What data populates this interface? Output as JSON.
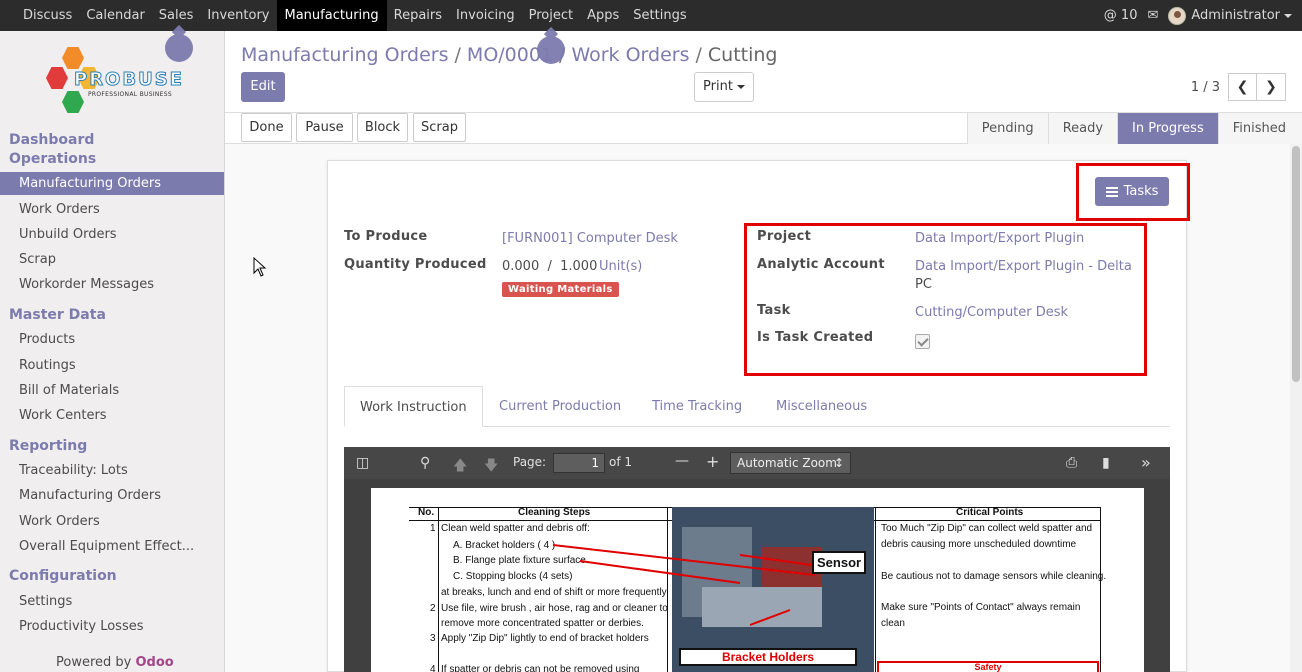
{
  "topbar": {
    "menu": [
      "Discuss",
      "Calendar",
      "Sales",
      "Inventory",
      "Manufacturing",
      "Repairs",
      "Invoicing",
      "Project",
      "Apps",
      "Settings"
    ],
    "active_menu": "Manufacturing",
    "notifications": "10",
    "user": "Administrator"
  },
  "logo": {
    "brand": "PROBUSE",
    "tagline": "PROFESSIONAL BUSINESS"
  },
  "sidebar": {
    "groups": [
      {
        "title": "Dashboard",
        "items": []
      },
      {
        "title": "Operations",
        "items": [
          "Manufacturing Orders",
          "Work Orders",
          "Unbuild Orders",
          "Scrap",
          "Workorder Messages"
        ]
      },
      {
        "title": "Master Data",
        "items": [
          "Products",
          "Routings",
          "Bill of Materials",
          "Work Centers"
        ]
      },
      {
        "title": "Reporting",
        "items": [
          "Traceability: Lots",
          "Manufacturing Orders",
          "Work Orders",
          "Overall Equipment Effect..."
        ]
      },
      {
        "title": "Configuration",
        "items": [
          "Settings",
          "Productivity Losses"
        ]
      }
    ],
    "active_item": "Manufacturing Orders",
    "powered_by": "Powered by",
    "powered_brand": "Odoo"
  },
  "breadcrumb": {
    "items": [
      "Manufacturing Orders",
      "MO/0001",
      "Work Orders"
    ],
    "current": "Cutting",
    "separator": "/"
  },
  "control": {
    "edit": "Edit",
    "print": "Print",
    "pager": "1 / 3"
  },
  "statusbar": {
    "buttons": [
      "Done",
      "Pause",
      "Block",
      "Scrap"
    ],
    "stages": [
      "Pending",
      "Ready",
      "In Progress",
      "Finished"
    ],
    "active_stage": "In Progress"
  },
  "form": {
    "tasks_button": "Tasks",
    "to_produce_label": "To Produce",
    "to_produce_value": "[FURN001] Computer Desk",
    "qty_label": "Quantity Produced",
    "qty_value": "0.000  /  1.000",
    "qty_unit": "Unit(s)",
    "status_badge": "Waiting Materials",
    "project_label": "Project",
    "project_value": "Data Import/Export Plugin",
    "analytic_label": "Analytic Account",
    "analytic_value_1": "Data Import/Export Plugin - Delta",
    "analytic_value_2": "PC",
    "task_label": "Task",
    "task_value": "Cutting/Computer Desk",
    "task_created_label": "Is Task Created",
    "task_created": true
  },
  "tabs": [
    "Work Instruction",
    "Current Production",
    "Time Tracking",
    "Miscellaneous"
  ],
  "active_tab": "Work Instruction",
  "pdf": {
    "page_label": "Page:",
    "page_value": "1",
    "of_label": "of 1",
    "zoom": "Automatic Zoom",
    "table": {
      "headers": {
        "no": "No.",
        "steps": "Cleaning Steps",
        "critical": "Critical Points"
      },
      "step_lines": [
        {
          "no": "1",
          "text": "Clean weld spatter and debris off:"
        },
        {
          "no": "",
          "text": "A. Bracket holders ( 4 )"
        },
        {
          "no": "",
          "text": "B. Flange plate fixture surface"
        },
        {
          "no": "",
          "text": "C. Stopping blocks (4 sets)"
        },
        {
          "no": "",
          "text": "at breaks, lunch and end of shift or more frequently"
        },
        {
          "no": "2",
          "text": "Use file, wire brush , air hose, rag and or cleaner to"
        },
        {
          "no": "",
          "text": "remove more concentrated spatter or derbies."
        },
        {
          "no": "3",
          "text": "Apply \"Zip Dip\" lightly to end of bracket holders"
        },
        {
          "no": "4",
          "text": "If spatter or debris can not be removed using"
        }
      ],
      "critical_lines": [
        "Too Much \"Zip Dip\" can collect weld spatter and",
        "debris causing more unscheduled downtime",
        "Be cautious not to damage sensors while cleaning.",
        "Make sure \"Points of Contact\" always remain",
        "clean"
      ],
      "sensor_label": "Sensor",
      "bracket_label": "Bracket Holders",
      "safety_label": "Safety"
    }
  }
}
